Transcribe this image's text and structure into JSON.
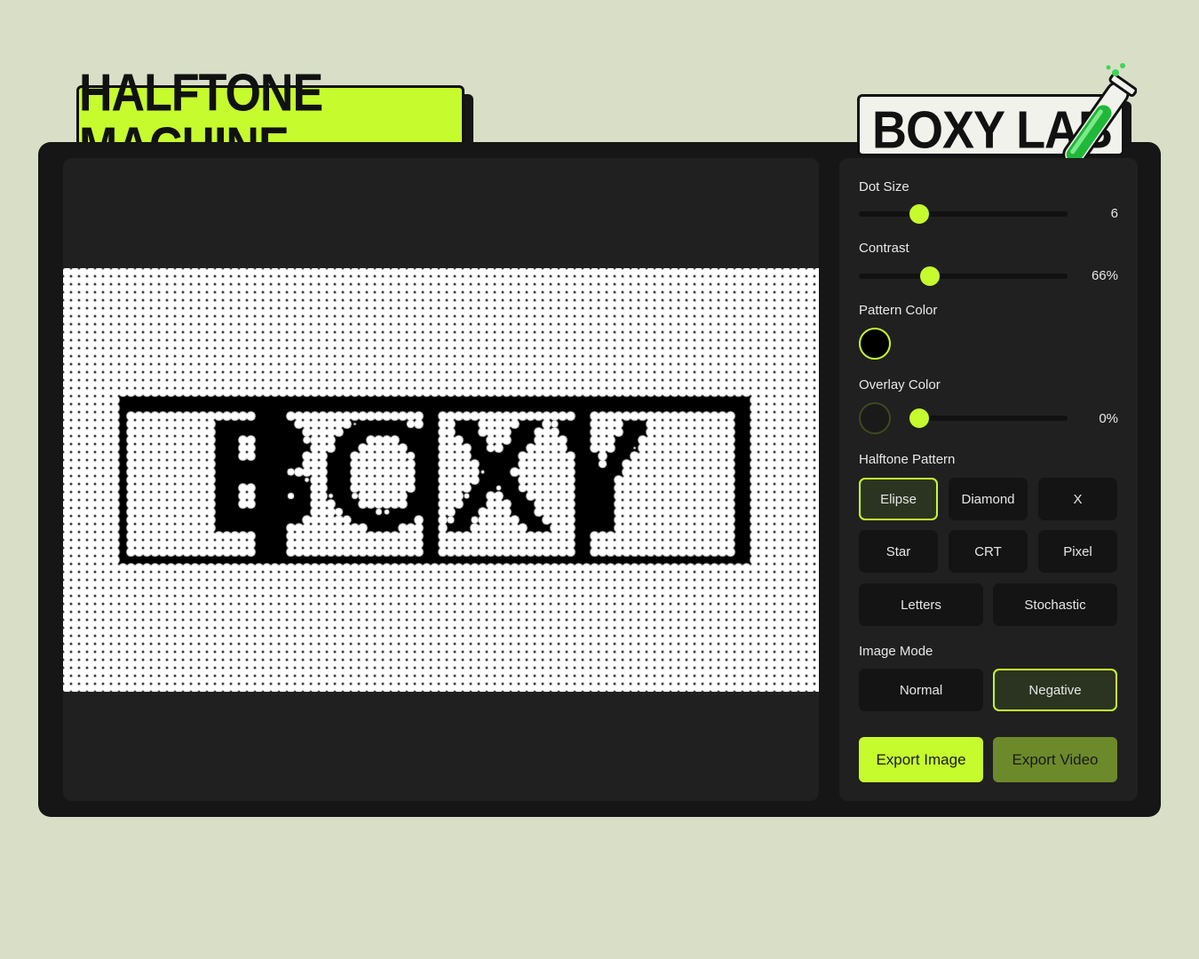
{
  "header": {
    "title": "HALFTONE MACHINE",
    "brand": "BOXY LAB",
    "brand_icon": "test-tube-flask-icon"
  },
  "controls": {
    "dot_size": {
      "label": "Dot Size",
      "value": 6,
      "value_text": "6",
      "fraction": 0.29
    },
    "contrast": {
      "label": "Contrast",
      "value": 66,
      "value_text": "66%",
      "fraction": 0.34
    },
    "pattern_color": {
      "label": "Pattern Color",
      "color": "#000000"
    },
    "overlay_color": {
      "label": "Overlay Color",
      "color": "#1a1a1a",
      "opacity": 0,
      "value_text": "0%"
    },
    "halftone_pattern": {
      "label": "Halftone Pattern",
      "selected": "Elipse",
      "options": [
        "Elipse",
        "Diamond",
        "X",
        "Star",
        "CRT",
        "Pixel",
        "Letters",
        "Stochastic"
      ]
    },
    "image_mode": {
      "label": "Image Mode",
      "selected": "Negative",
      "options": [
        "Normal",
        "Negative"
      ]
    }
  },
  "export": {
    "image_label": "Export Image",
    "video_label": "Export Video"
  },
  "preview": {
    "image_content": "BOXY"
  },
  "colors": {
    "accent": "#c6fb2e",
    "export_video_bg": "#6c8a2a",
    "page_bg": "#d8dfc6",
    "frame_bg": "#161616",
    "panel_bg": "#202020"
  }
}
